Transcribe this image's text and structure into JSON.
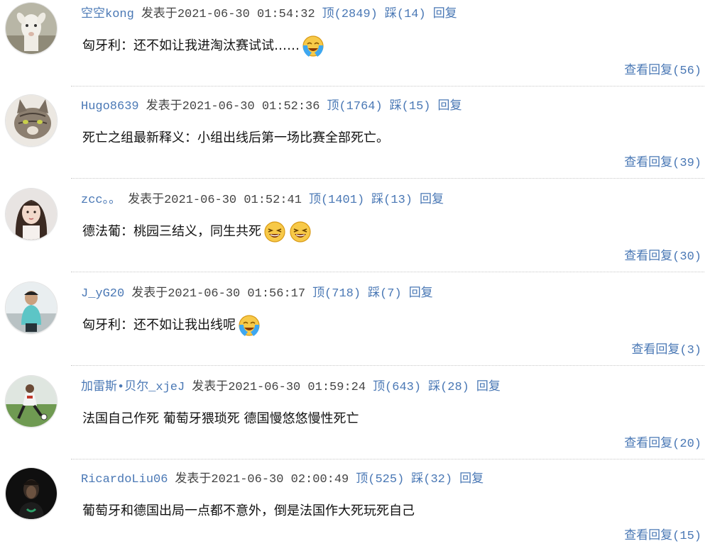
{
  "labels": {
    "posted_prefix": "发表于",
    "reply": "回复"
  },
  "comments": [
    {
      "username": "空空kong",
      "datetime": "2021-06-30 01:54:32",
      "upvote": "顶(2849)",
      "downvote": "踩(14)",
      "text": "匈牙利：还不如让我进淘汰赛试试……",
      "emojis": [
        "crying-laugh-emoji"
      ],
      "view_replies": "查看回复(56)",
      "avatar_icon": "goat-avatar"
    },
    {
      "username": "Hugo8639",
      "datetime": "2021-06-30 01:52:36",
      "upvote": "顶(1764)",
      "downvote": "踩(15)",
      "text": "死亡之组最新释义：小组出线后第一场比赛全部死亡。",
      "emojis": [],
      "view_replies": "查看回复(39)",
      "avatar_icon": "cat-avatar"
    },
    {
      "username": "zcc。。",
      "datetime": "2021-06-30 01:52:41",
      "upvote": "顶(1401)",
      "downvote": "踩(13)",
      "text": "德法葡：桃园三结义，同生共死",
      "emojis": [
        "laughing-emoji",
        "laughing-emoji"
      ],
      "view_replies": "查看回复(30)",
      "avatar_icon": "woman-avatar"
    },
    {
      "username": "J_yG20",
      "datetime": "2021-06-30 01:56:17",
      "upvote": "顶(718)",
      "downvote": "踩(7)",
      "text": "匈牙利：还不如让我出线呢",
      "emojis": [
        "crying-laugh-emoji"
      ],
      "view_replies": "查看回复(3)",
      "avatar_icon": "man-avatar"
    },
    {
      "username": "加雷斯•贝尔_xjeJ",
      "datetime": "2021-06-30 01:59:24",
      "upvote": "顶(643)",
      "downvote": "踩(28)",
      "text": "法国自己作死 葡萄牙猥琐死 德国慢悠悠慢性死亡",
      "emojis": [],
      "view_replies": "查看回复(20)",
      "avatar_icon": "soccer-player-avatar"
    },
    {
      "username": "RicardoLiu06",
      "datetime": "2021-06-30 02:00:49",
      "upvote": "顶(525)",
      "downvote": "踩(32)",
      "text": "葡萄牙和德国出局一点都不意外，倒是法国作大死玩死自己",
      "emojis": [],
      "view_replies": "查看回复(15)",
      "avatar_icon": "dark-portrait-avatar"
    }
  ]
}
